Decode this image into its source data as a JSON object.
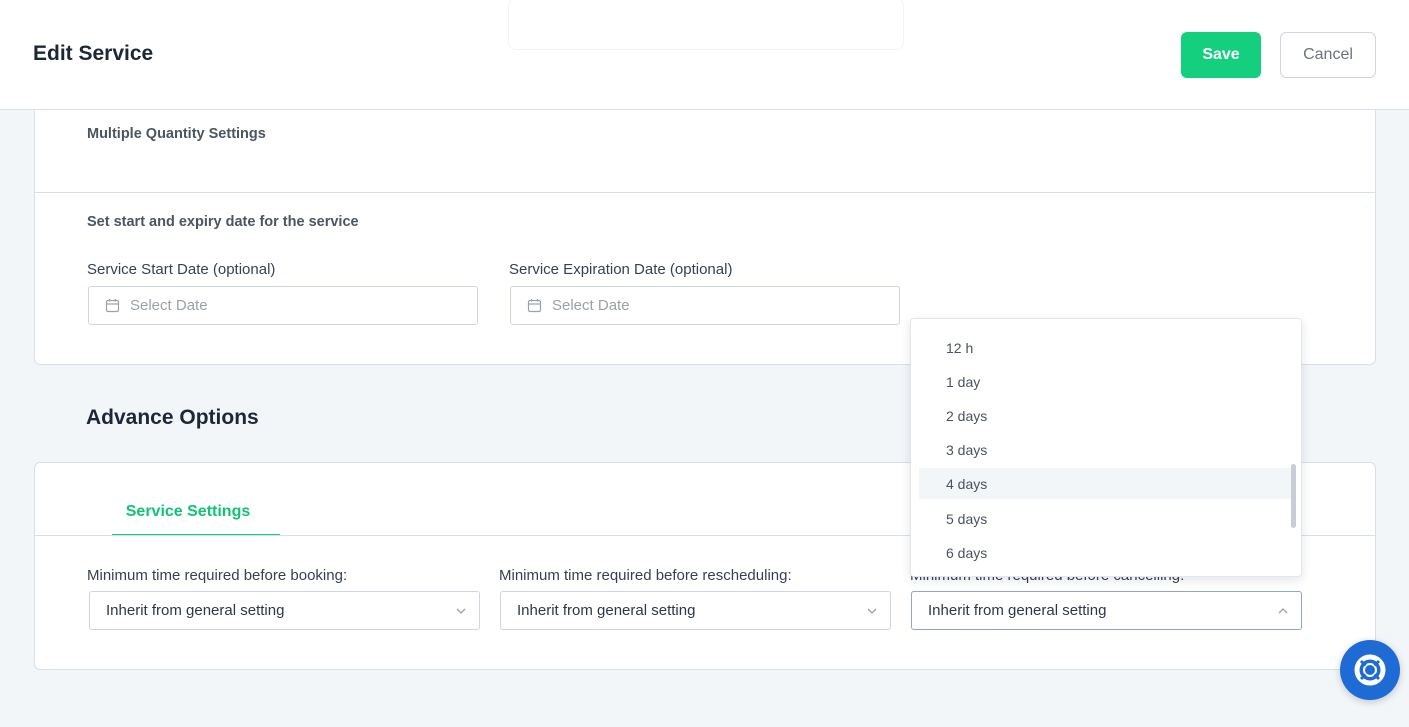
{
  "header": {
    "title": "Edit Service",
    "save_label": "Save",
    "cancel_label": "Cancel"
  },
  "quantity": {
    "section_label": "Multiple Quantity Settings"
  },
  "dates": {
    "section_label": "Set start and expiry date for the service",
    "start_label": "Service Start Date (optional)",
    "start_placeholder": "Select Date",
    "expiry_label": "Service Expiration Date (optional)",
    "expiry_placeholder": "Select Date"
  },
  "advance": {
    "title": "Advance Options",
    "tab_label": "Service Settings",
    "booking_label": "Minimum time required before booking:",
    "booking_value": "Inherit from general setting",
    "reschedule_label": "Minimum time required before rescheduling:",
    "reschedule_value": "Inherit from general setting",
    "cancel_label": "Minimum time required before cancelling:",
    "cancel_value": "Inherit from general setting"
  },
  "dropdown": {
    "options": [
      "12 h",
      "1 day",
      "2 days",
      "3 days",
      "4 days",
      "5 days",
      "6 days"
    ],
    "highlighted": "4 days"
  },
  "colors": {
    "accent": "#14d07e",
    "help_button": "#1f6bd6"
  },
  "icons": {
    "date": "calendar-icon",
    "select": "chevron-down-icon",
    "select_open": "chevron-up-icon",
    "help": "lifebuoy-icon"
  }
}
